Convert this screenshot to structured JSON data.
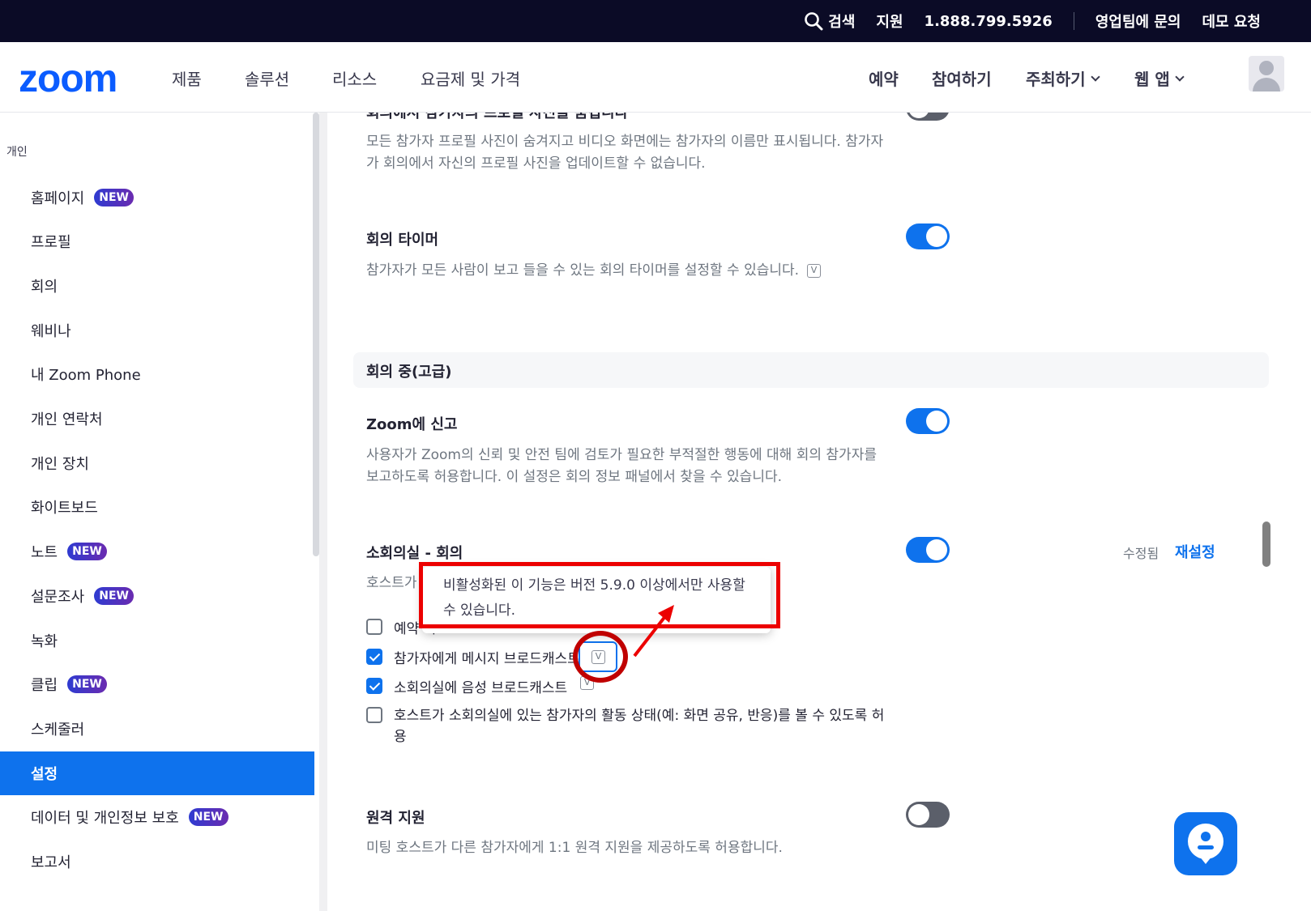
{
  "topbar": {
    "search": "검색",
    "support": "지원",
    "phone": "1.888.799.5926",
    "contact_sales": "영업팀에 문의",
    "request_demo": "데모 요청"
  },
  "nav": {
    "logo": "zoom",
    "products": "제품",
    "solutions": "솔루션",
    "resources": "리소스",
    "pricing": "요금제 및 가격",
    "schedule": "예약",
    "join": "참여하기",
    "host": "주최하기",
    "web_app": "웹 앱"
  },
  "sidebar": {
    "heading": "개인",
    "new_badge": "NEW",
    "items": [
      {
        "label": "홈페이지"
      },
      {
        "label": "프로필"
      },
      {
        "label": "회의"
      },
      {
        "label": "웨비나"
      },
      {
        "label": "내 Zoom Phone"
      },
      {
        "label": "개인 연락처"
      },
      {
        "label": "개인 장치"
      },
      {
        "label": "화이트보드"
      },
      {
        "label": "노트"
      },
      {
        "label": "설문조사"
      },
      {
        "label": "녹화"
      },
      {
        "label": "클립"
      },
      {
        "label": "스케줄러"
      },
      {
        "label": "설정"
      },
      {
        "label": "데이터 및 개인정보 보호"
      },
      {
        "label": "보고서"
      }
    ]
  },
  "settings": {
    "hide_photos": {
      "title": "회의에서 참가자의 프로필 사진을 숨깁니다",
      "desc": "모든 참가자 프로필 사진이 숨겨지고 비디오 화면에는 참가자의 이름만 표시됩니다. 참가자가 회의에서 자신의 프로필 사진을 업데이트할 수 없습니다.",
      "enabled": false
    },
    "meeting_timer": {
      "title": "회의 타이머",
      "desc": "참가자가 모든 사람이 보고 들을 수 있는 회의 타이머를 설정할 수 있습니다.",
      "enabled": true
    },
    "section_title": "회의 중(고급)",
    "report_to_zoom": {
      "title": "Zoom에 신고",
      "desc": "사용자가 Zoom의 신뢰 및 안전 팀에 검토가 필요한 부적절한 행동에 대해 회의 참가자를 보고하도록 허용합니다. 이 설정은 회의 정보 패널에서 찾을 수 있습니다.",
      "enabled": true
    },
    "breakout": {
      "title": "소회의실 - 회의",
      "desc_start": "호스트가 회",
      "modified": "수정됨",
      "reset": "재설정",
      "enabled": true,
      "options": [
        {
          "label": "예약 시",
          "checked": false
        },
        {
          "label": "참가자에게 메시지 브로드캐스트",
          "checked": true
        },
        {
          "label": "소회의실에 음성 브로드캐스트",
          "checked": true
        },
        {
          "label": "호스트가 소회의실에 있는 참가자의 활동 상태(예: 화면 공유, 반응)를 볼 수 있도록 허용",
          "checked": false
        }
      ]
    },
    "remote_support": {
      "title": "원격 지원",
      "desc": "미팅 호스트가 다른 참가자에게 1:1 원격 지원을 제공하도록 허용합니다.",
      "enabled": false
    }
  },
  "tooltip": {
    "text": "비활성화된 이 기능은 버전 5.9.0 이상에서만 사용할 수 있습니다."
  },
  "version_icon": "V",
  "colors": {
    "brand": "#0b5cff",
    "accent": "#0e72ed",
    "annotation_red": "#ec0000"
  }
}
